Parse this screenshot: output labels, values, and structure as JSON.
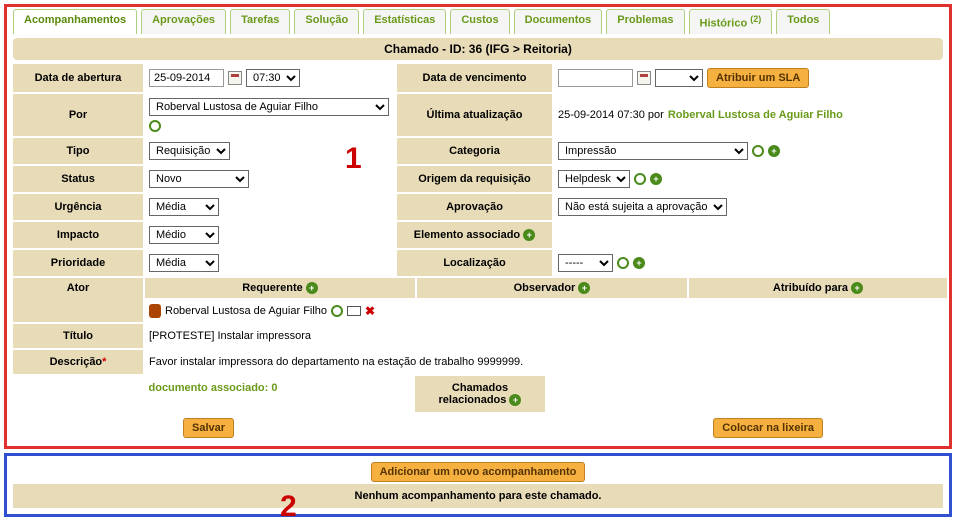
{
  "tabs": [
    "Acompanhamentos",
    "Aprovações",
    "Tarefas",
    "Solução",
    "Estatísticas",
    "Custos",
    "Documentos",
    "Problemas",
    "Histórico",
    "Todos"
  ],
  "historico_count": "(2)",
  "header": "Chamado - ID: 36 (IFG > Reitoria)",
  "labels": {
    "data_abertura": "Data de abertura",
    "data_vencimento": "Data de vencimento",
    "por": "Por",
    "ultima_atualizacao": "Última atualização",
    "tipo": "Tipo",
    "categoria": "Categoria",
    "status": "Status",
    "origem": "Origem da requisição",
    "urgencia": "Urgência",
    "aprovacao": "Aprovação",
    "impacto": "Impacto",
    "elemento": "Elemento associado",
    "prioridade": "Prioridade",
    "localizacao": "Localização",
    "ator": "Ator",
    "requerente": "Requerente",
    "observador": "Observador",
    "atribuido": "Atribuído para",
    "titulo": "Título",
    "descricao": "Descrição",
    "chamados_rel": "Chamados relacionados"
  },
  "values": {
    "data_abertura_date": "25-09-2014",
    "data_abertura_time": "07:30",
    "por": "Roberval Lustosa de Aguiar Filho",
    "ultima_date": "25-09-2014 07:30 por ",
    "ultima_user": "Roberval Lustosa de Aguiar Filho",
    "tipo": "Requisição",
    "categoria": "Impressão",
    "status": "Novo",
    "origem": "Helpdesk",
    "urgencia": "Média",
    "aprovacao": "Não está sujeita a aprovação",
    "impacto": "Médio",
    "prioridade": "Média",
    "localizacao": "-----",
    "requerente_nome": "Roberval Lustosa de Aguiar Filho",
    "titulo": "[PROTESTE] Instalar impressora",
    "descricao": "Favor instalar impressora do departamento na estação de trabalho 9999999.",
    "doc_assoc": "documento associado: 0"
  },
  "buttons": {
    "atribuir_sla": "Atribuir um SLA",
    "salvar": "Salvar",
    "lixeira": "Colocar na lixeira",
    "add_acomp": "Adicionar um novo acompanhamento"
  },
  "section2": {
    "no_follow": "Nenhum acompanhamento para este chamado."
  },
  "annotations": {
    "one": "1",
    "two": "2"
  }
}
